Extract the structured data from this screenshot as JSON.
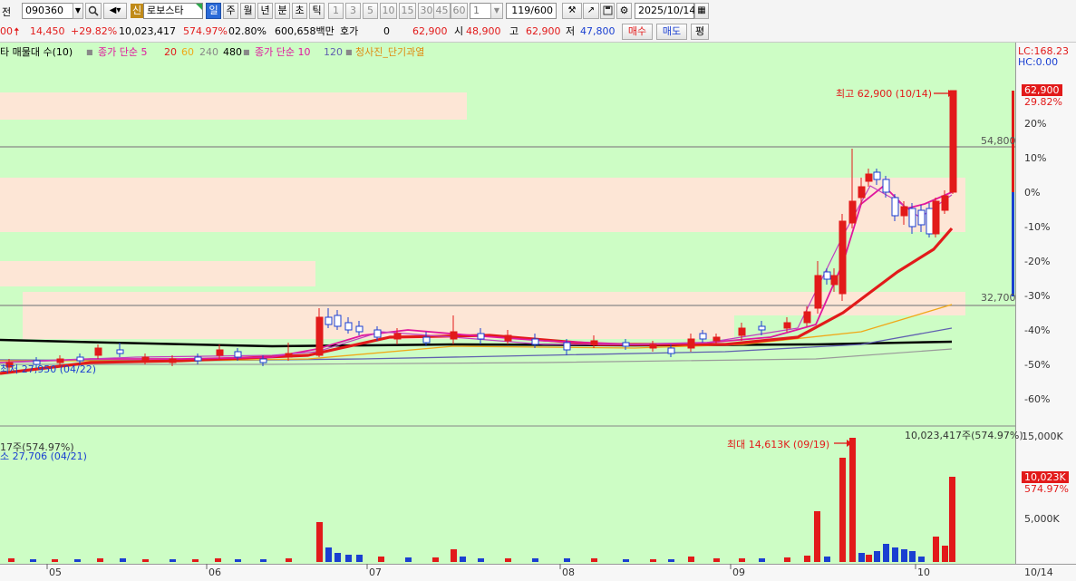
{
  "toolbar": {
    "left_label": "전",
    "code": "090360",
    "market_badge": "신",
    "stock_name": "로보스타",
    "periods": [
      "일",
      "주",
      "월",
      "년",
      "분",
      "초",
      "틱"
    ],
    "active_period": "일",
    "intervals": [
      "1",
      "3",
      "5",
      "10",
      "15",
      "30",
      "45",
      "60"
    ],
    "unit_value": "1",
    "count": "119/600",
    "date": "2025/10/14"
  },
  "quote": {
    "prefix": "00",
    "change": "14,450",
    "change_pct": "+29.82%",
    "volume": "10,023,417",
    "volume_ratio": "574.97%",
    "turnover": "02.80%",
    "amount": "600,658백만",
    "hoga_label": "호가",
    "hoga_value": "0",
    "price": "62,900",
    "open_label": "시",
    "open": "48,900",
    "high_label": "고",
    "high": "62,900",
    "low_label": "저",
    "low": "47,800",
    "buy_label": "매수",
    "sell_label": "매도",
    "eval_label": "평"
  },
  "legend": {
    "item1": "타 매물대 수(10)",
    "ma_short_label": "종가 단순 5",
    "ma_short_vals": [
      "20",
      "60",
      "240",
      "480"
    ],
    "ma_long_label": "종가 단순 10",
    "ma_long_val": "120",
    "signal": "청사진_단기과열"
  },
  "price_axis": {
    "lc": "LC:168.23",
    "hc": "HC:0.00",
    "current_tag": "62,900",
    "current_pct": "29.82%",
    "ticks": [
      "20%",
      "10%",
      "0%",
      "-10%",
      "-20%",
      "-30%",
      "-40%",
      "-50%",
      "-60%"
    ],
    "line_high": "54,800",
    "line_low": "32,700"
  },
  "annotations": {
    "max_price": "최고 62,900 (10/14)",
    "low_price": "최저 27,950 (04/22)",
    "max_volume": "최대 14,613K (09/19)",
    "volume_now": "10,023,417주(574.97%)",
    "vol_left1": "17주(574.97%)",
    "vol_left2": "소 27,706 (04/21)"
  },
  "volume_axis": {
    "ticks": [
      "15,000K",
      "5,000K"
    ],
    "current_tag": "10,023K",
    "current_pct": "574.97%"
  },
  "x_axis": {
    "labels": [
      "05",
      "06",
      "07",
      "08",
      "09",
      "10"
    ],
    "right": "10/14"
  },
  "colors": {
    "up": "#e21a1a",
    "down": "#1a3fd1",
    "chart_bg": "#cdfdc5",
    "ma5": "#e0189e",
    "ma20": "#e21a1a",
    "ma60": "#f0a818",
    "ma120": "#6060b0",
    "ma240": "#000000",
    "band": "#fde6d6"
  },
  "chart_data": {
    "type": "candlestick",
    "ylim": [
      32700,
      62900
    ],
    "last": {
      "open": 48900,
      "high": 62900,
      "low": 47800,
      "close": 62900,
      "volume": 10023417
    },
    "levels": [
      54800,
      32700
    ]
  }
}
